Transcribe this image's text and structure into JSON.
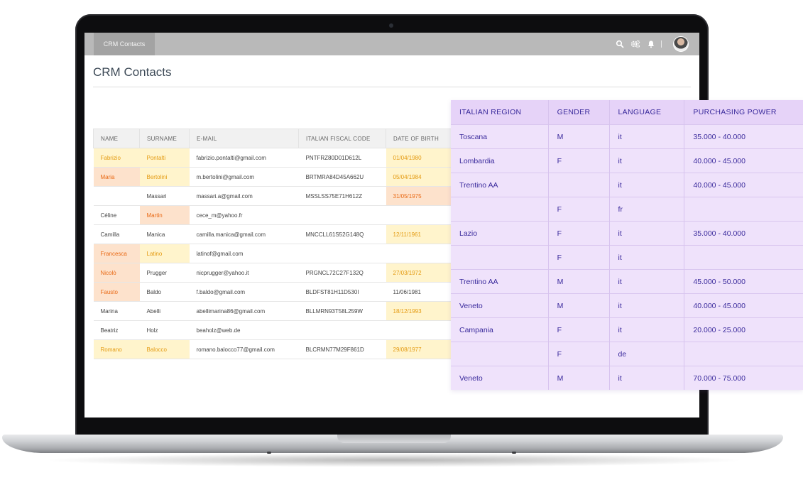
{
  "app": {
    "tab_label": "CRM Contacts",
    "page_title": "CRM Contacts"
  },
  "toolbar_icons": [
    "search-icon",
    "settings-icon",
    "bell-icon"
  ],
  "contacts": {
    "columns": [
      "NAME",
      "SURNAME",
      "E-MAIL",
      "ITALIAN FISCAL CODE",
      "DATE OF BIRTH"
    ],
    "rows": [
      [
        "Fabrizio",
        "Pontalti",
        "fabrizio.pontalti@gmail.com",
        "PNTFRZ80D01D612L",
        "01/04/1980"
      ],
      [
        "Maria",
        "Bertolini",
        "m.bertolini@gmail.com",
        "BRTMRA84D45A662U",
        "05/04/1984"
      ],
      [
        "",
        "Massari",
        "massari.a@gmail.com",
        "MSSLSS75E71H612Z",
        "31/05/1975"
      ],
      [
        "Céline",
        "Martin",
        "cece_m@yahoo.fr",
        "",
        ""
      ],
      [
        "Camilla",
        "Manica",
        "camilla.manica@gmail.com",
        "MNCCLL61S52G148Q",
        "12/11/1961"
      ],
      [
        "Francesca",
        "Latino",
        "latinof@gmail.com",
        "",
        ""
      ],
      [
        "Nicolò",
        "Prugger",
        "nicprugger@yahoo.it",
        "PRGNCL72C27F132Q",
        "27/03/1972"
      ],
      [
        "Fausto",
        "Baldo",
        "f.baldo@gmail.com",
        "BLDFST81H11D530I",
        "11/06/1981"
      ],
      [
        "Marina",
        "Abelli",
        "abellimarina86@gmail.com",
        "BLLMRN93T58L259W",
        "18/12/1993"
      ],
      [
        "Beatriz",
        "Holz",
        "beaholz@web.de",
        "",
        ""
      ],
      [
        "Romano",
        "Balocco",
        "romano.balocco77@gmail.com",
        "BLCRMN77M29F861D",
        "29/08/1977"
      ]
    ]
  },
  "enrichment": {
    "columns": [
      "ITALIAN REGION",
      "GENDER",
      "LANGUAGE",
      "PURCHASING POWER"
    ],
    "rows": [
      [
        "Toscana",
        "M",
        "it",
        "35.000 - 40.000"
      ],
      [
        "Lombardia",
        "F",
        "it",
        "40.000 - 45.000"
      ],
      [
        "Trentino AA",
        "",
        "it",
        "40.000 - 45.000"
      ],
      [
        "",
        "F",
        "fr",
        ""
      ],
      [
        "Lazio",
        "F",
        "it",
        "35.000 - 40.000"
      ],
      [
        "",
        "F",
        "it",
        ""
      ],
      [
        "Trentino AA",
        "M",
        "it",
        "45.000 - 50.000"
      ],
      [
        "Veneto",
        "M",
        "it",
        "40.000 - 45.000"
      ],
      [
        "Campania",
        "F",
        "it",
        "20.000 - 25.000"
      ],
      [
        "",
        "F",
        "de",
        ""
      ],
      [
        "Veneto",
        "M",
        "it",
        "70.000 - 75.000"
      ]
    ]
  },
  "colors": {
    "highlight_orange_bg": "#fde6cf",
    "highlight_yellow_bg": "#fff4cc",
    "enrichment_bg": "#efe2fb",
    "enrichment_text": "#3a2a9c",
    "topbar": "#b9b9b9"
  }
}
